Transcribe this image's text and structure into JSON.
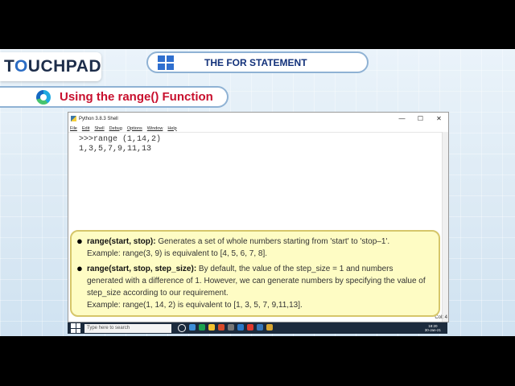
{
  "brand": {
    "logo_prefix": "T",
    "logo_o": "O",
    "logo_rest": "UCHPAD"
  },
  "header": {
    "title": "THE FOR STATEMENT",
    "section": "Using the range() Function"
  },
  "shell": {
    "title": "Python 3.8.3 Shell",
    "controls": [
      "—",
      "☐",
      "✕"
    ],
    "menu": [
      "File",
      "Edit",
      "Shell",
      "Debug",
      "Options",
      "Window",
      "Help"
    ],
    "code_lines": [
      ">>>range (1,14,2)",
      "1,3,5,7,9,11,13"
    ],
    "status": "Col: 4"
  },
  "taskbar": {
    "search_placeholder": "Type here to search",
    "time": "18:20",
    "date": "30-Jan-21"
  },
  "notes": [
    {
      "term": "range(start, stop):",
      "text": " Generates a set of whole numbers starting from 'start' to 'stop–1'.",
      "example": "Example: range(3, 9) is equivalent to [4, 5, 6, 7, 8]."
    },
    {
      "term": "range(start, stop, step_size):",
      "text": " By default, the value of the step_size = 1 and numbers generated with a difference of 1. However, we can generate numbers by specifying the value of step_size according to our requirement.",
      "example": "Example: range(1, 14, 2) is equivalent to [1, 3, 5, 7, 9,11,13]."
    }
  ],
  "colors": {
    "accent": "#c8102e",
    "title_blue": "#12317a",
    "tooltip_bg": "#fefcc4",
    "tooltip_border": "#d6c66a"
  }
}
